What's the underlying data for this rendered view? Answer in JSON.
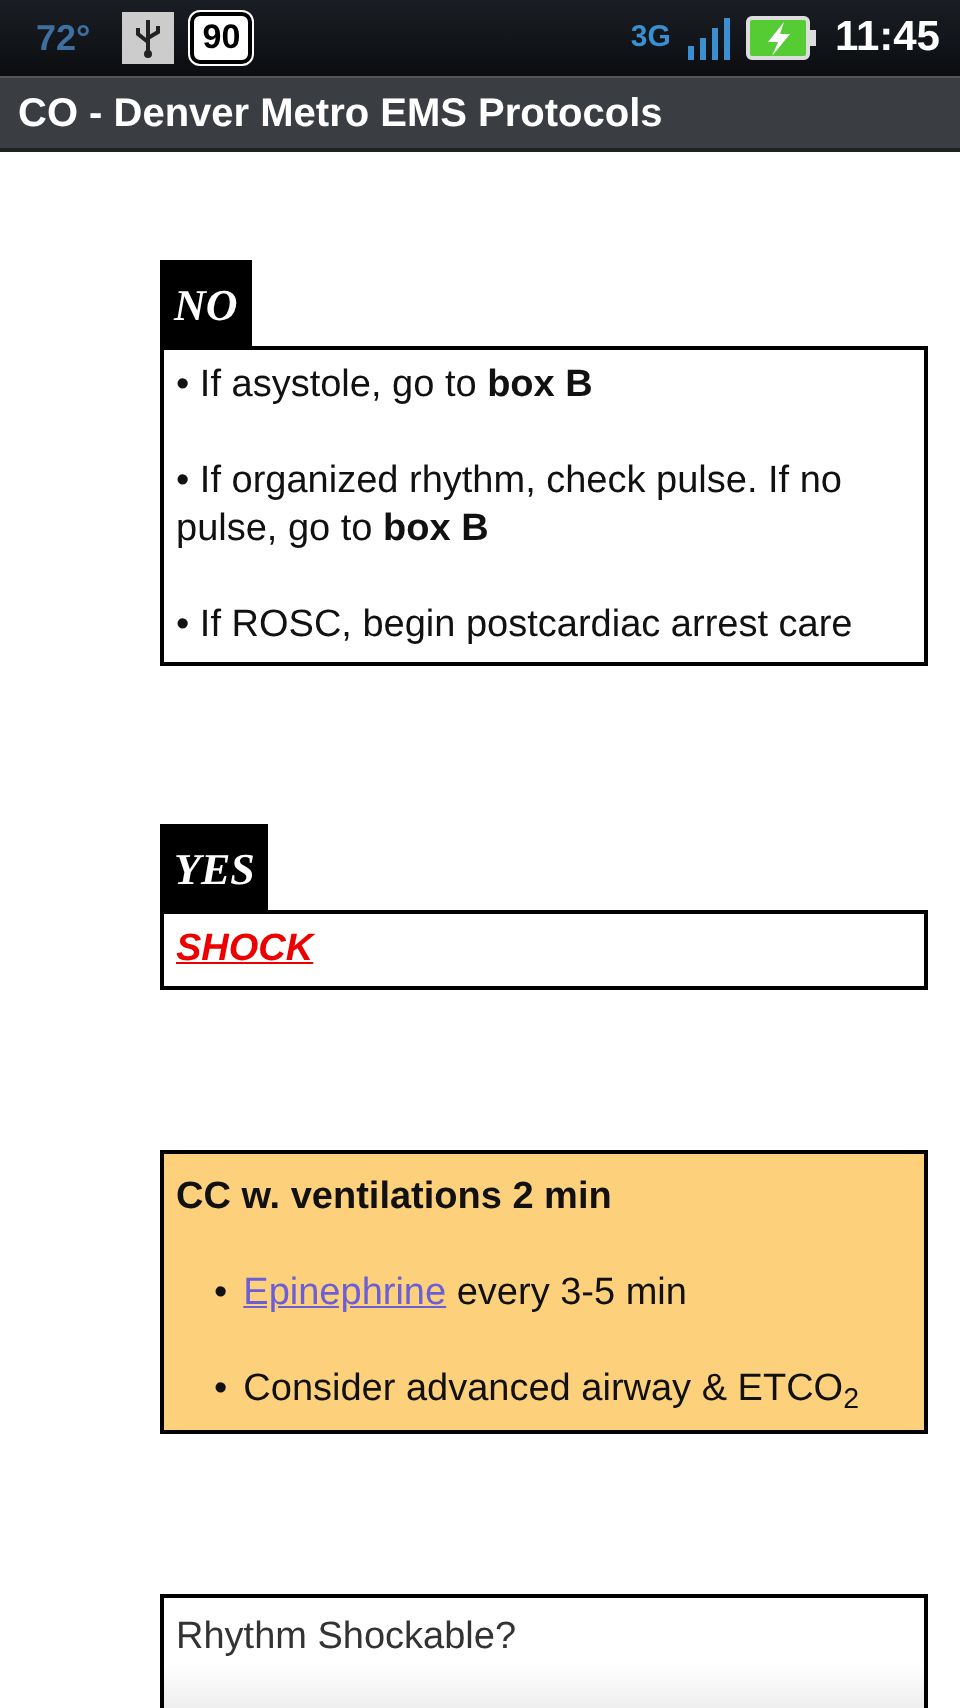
{
  "status_bar": {
    "temperature": "72°",
    "battery_badge": "90",
    "network": "3G",
    "time": "11:45"
  },
  "window": {
    "title": "CO - Denver Metro EMS Protocols"
  },
  "blocks": [
    {
      "kind": "decision",
      "tag": "NO",
      "lines": [
        {
          "kind": "text",
          "text": "• If asystole, go to **box B**"
        },
        {
          "kind": "text",
          "text": "• If organized rhythm, check pulse. If no pulse, go to **box B**"
        },
        {
          "kind": "text",
          "text": "• If ROSC, begin postcardiac arrest care"
        }
      ]
    },
    {
      "kind": "decision",
      "tag": "YES",
      "lines": [
        {
          "kind": "alert-link",
          "text": "SHOCK"
        }
      ]
    },
    {
      "kind": "action",
      "heading": "CC w. ventilations 2 min",
      "items": [
        {
          "bullet": "•",
          "link": "Epinephrine",
          "text": " every 3-5 min"
        },
        {
          "bullet": "•",
          "text": "Consider advanced airway & ETCO$_{2}$"
        }
      ]
    },
    {
      "kind": "question",
      "text": "Rhythm Shockable?"
    }
  ]
}
